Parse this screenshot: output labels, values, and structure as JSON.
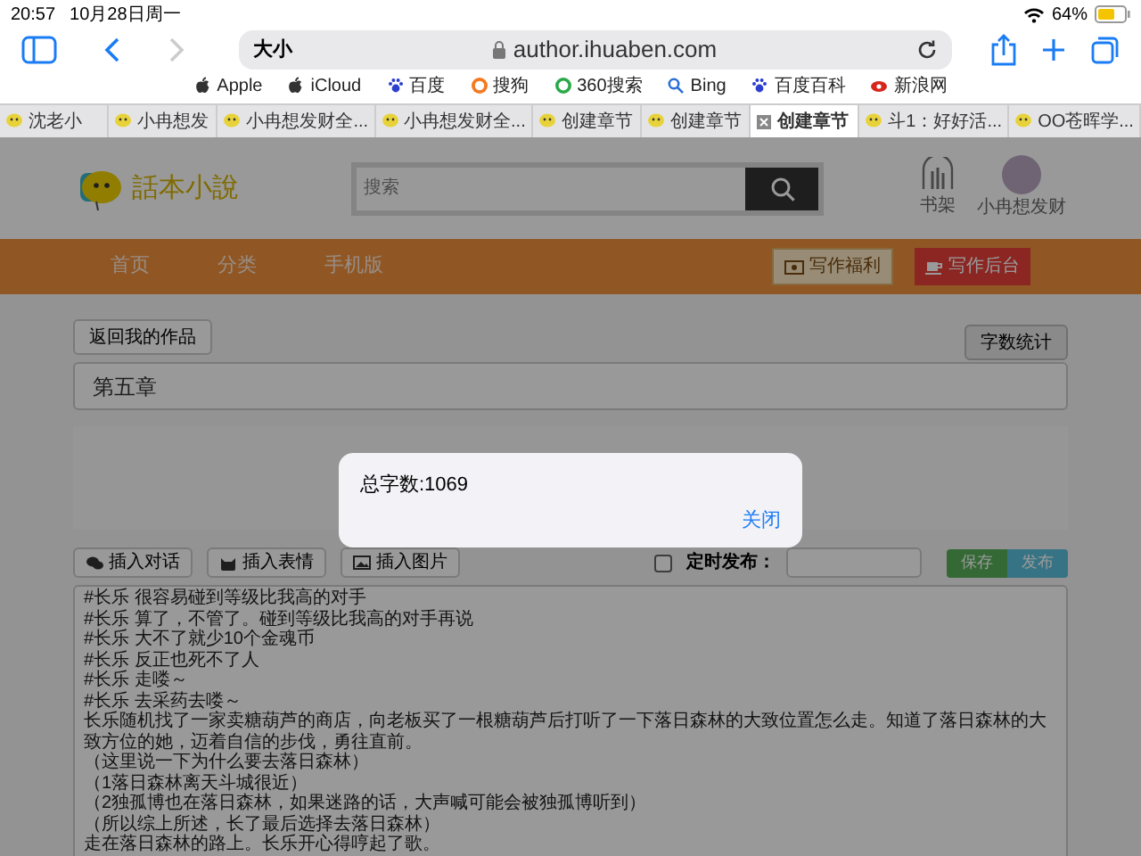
{
  "status_bar": {
    "time": "20:57",
    "date": "10月28日周一",
    "battery": "64%"
  },
  "toolbar": {
    "text_size": "大小",
    "url": "author.ihuaben.com"
  },
  "bookmarks": [
    {
      "label": "Apple",
      "kind": "apple"
    },
    {
      "label": "iCloud",
      "kind": "apple"
    },
    {
      "label": "百度",
      "kind": "paw"
    },
    {
      "label": "搜狗",
      "kind": "sogou"
    },
    {
      "label": "360搜索",
      "kind": "ring"
    },
    {
      "label": "Bing",
      "kind": "search"
    },
    {
      "label": "百度百科",
      "kind": "paw"
    },
    {
      "label": "新浪网",
      "kind": "eye"
    }
  ],
  "tabs": [
    {
      "label": "沈老小",
      "selected": false
    },
    {
      "label": "小冉想发",
      "selected": false
    },
    {
      "label": "小冉想发财全...",
      "selected": false
    },
    {
      "label": "小冉想发财全...",
      "selected": false
    },
    {
      "label": "创建章节",
      "selected": false
    },
    {
      "label": "创建章节",
      "selected": false
    },
    {
      "label": "创建章节",
      "selected": true
    },
    {
      "label": "斗1：好好活...",
      "selected": false
    },
    {
      "label": "OO苍晖学...",
      "selected": false
    }
  ],
  "site_header": {
    "logo": "話本小說",
    "search_placeholder": "搜索",
    "bookshelf": "书架",
    "user": "小冉想发财"
  },
  "nav": {
    "items": [
      "首页",
      "分类",
      "手机版"
    ],
    "buttons": [
      {
        "label": "写作福利",
        "kind": "welfare"
      },
      {
        "label": "写作后台",
        "kind": "backend"
      }
    ]
  },
  "editor": {
    "back_button": "返回我的作品",
    "count_button": "字数统计",
    "chapter_title": "第五章",
    "insert_buttons": [
      {
        "label": "插入对话",
        "kind": "chat"
      },
      {
        "label": "插入表情",
        "kind": "emoji"
      },
      {
        "label": "插入图片",
        "kind": "image"
      }
    ],
    "scheduled": {
      "label": "定时发布：",
      "checked": false
    },
    "save": "保存",
    "publish": "发布",
    "lines": [
      "#长乐 很容易碰到等级比我高的对手",
      "#长乐 算了，不管了。碰到等级比我高的对手再说",
      "#长乐 大不了就少10个金魂币",
      "#长乐 反正也死不了人",
      "#长乐 走喽～",
      "#长乐 去采药去喽～",
      "长乐随机找了一家卖糖葫芦的商店，向老板买了一根糖葫芦后打听了一下落日森林的大致位置怎么走。知道了落日森林的大致方位的她，迈着自信的步伐，勇往直前。",
      "（这里说一下为什么要去落日森林）",
      "（1落日森林离天斗城很近）",
      "（2独孤博也在落日森林，如果迷路的话，大声喊可能会被独孤博听到）",
      "（所以综上所述，长了最后选择去落日森林）",
      "走在落日森林的路上。长乐开心得哼起了歌。"
    ]
  },
  "dialog": {
    "message": "总字数:1069",
    "close": "关闭"
  }
}
